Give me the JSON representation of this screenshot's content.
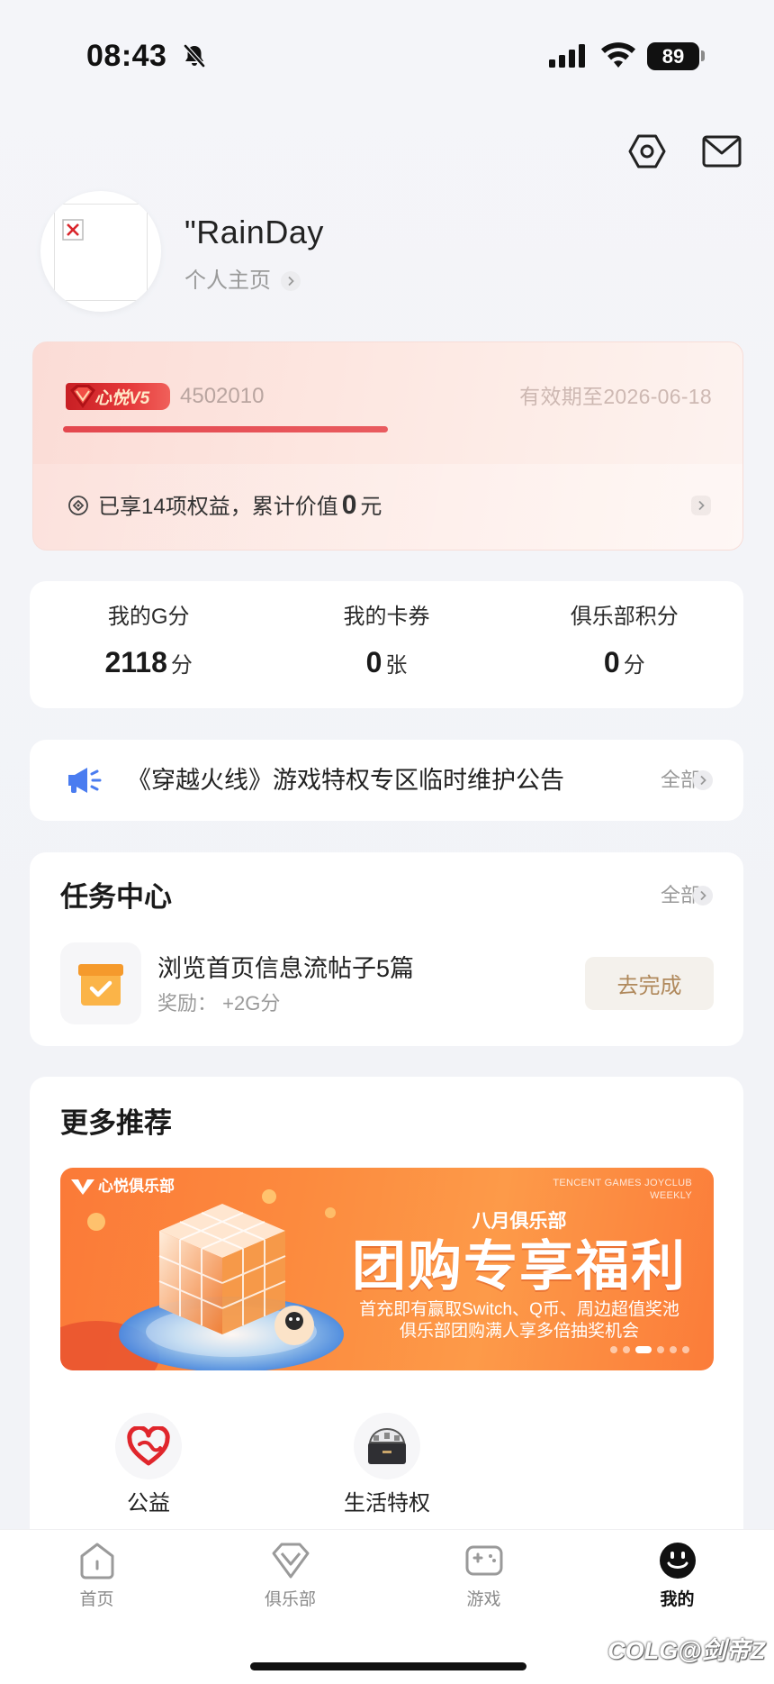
{
  "status_bar": {
    "time": "08:43",
    "battery": "89"
  },
  "top_actions": [
    {
      "icon": "settings-hexagon-icon"
    },
    {
      "icon": "mail-icon"
    }
  ],
  "profile": {
    "name": "\"RainDay",
    "homepage_label": "个人主页"
  },
  "vip": {
    "badge": "心悦V5",
    "member_id": "4502010",
    "expiry": "有效期至2026-06-18",
    "level_progress": 0.5,
    "benefits": {
      "prefix": "已享14项权益，累计价值",
      "value": "0",
      "suffix": "元"
    }
  },
  "stats": [
    {
      "label": "我的G分",
      "value": "2118",
      "unit": "分"
    },
    {
      "label": "我的卡券",
      "value": "0",
      "unit": "张"
    },
    {
      "label": "俱乐部积分",
      "value": "0",
      "unit": "分"
    }
  ],
  "notice": {
    "text": "《穿越火线》游戏特权专区临时维护公告",
    "more": "全部"
  },
  "tasks": {
    "title": "任务中心",
    "more": "全部",
    "items": [
      {
        "title": "浏览首页信息流帖子5篇",
        "reward_label": "奖励：",
        "reward_value": "+2G分",
        "action": "去完成"
      }
    ]
  },
  "recommend": {
    "title": "更多推荐",
    "banner": {
      "brand": "心悦俱乐部",
      "en_line1": "TENCENT GAMES JOYCLUB",
      "en_line2": "WEEKLY",
      "eyebrow": "八月俱乐部",
      "headline": "团购专享福利",
      "line1": "首充即有赢取Switch、Q币、周边超值奖池",
      "line2": "俱乐部团购满人享多倍抽奖机会",
      "slide_count": 6,
      "active_slide": 3
    },
    "shortcuts": [
      {
        "label": "公益",
        "icon": "charity-heart-icon"
      },
      {
        "label": "生活特权",
        "icon": "gift-box-icon"
      }
    ]
  },
  "tabs": [
    {
      "label": "首页",
      "icon": "home-icon",
      "active": false
    },
    {
      "label": "俱乐部",
      "icon": "club-diamond-icon",
      "active": false
    },
    {
      "label": "游戏",
      "icon": "gamepad-icon",
      "active": false
    },
    {
      "label": "我的",
      "icon": "profile-smiley-icon",
      "active": true
    }
  ],
  "watermark": "COLG@剑帝Z",
  "colors": {
    "accent_red": "#e4474e",
    "notice_blue": "#4a7cf0",
    "task_orange": "#f9a83c",
    "banner_orange": "#fc8a3e",
    "action_text": "#b0895c"
  }
}
